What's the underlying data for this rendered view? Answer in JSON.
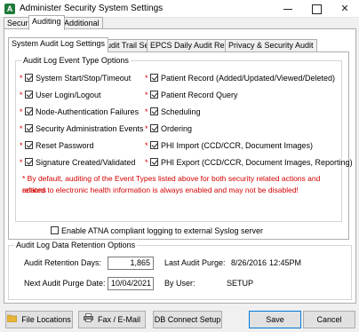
{
  "window": {
    "icon_letter": "A",
    "title": "Administer Security System Settings"
  },
  "top_tabs": [
    "Security",
    "Auditing",
    "Additional Options"
  ],
  "inner_tabs": [
    "System Audit Log Settings",
    "PHI Audit Trail Settings",
    "EPCS Daily Audit Reporting",
    "Privacy & Security Audit"
  ],
  "event_types": {
    "legend": "Audit Log Event Type Options",
    "left": [
      {
        "label": "System Start/Stop/Timeout",
        "required": true,
        "checked": true
      },
      {
        "label": "User Login/Logout",
        "required": true,
        "checked": true
      },
      {
        "label": "Node-Authentication Failures",
        "required": true,
        "checked": true
      },
      {
        "label": "Security Administration Events",
        "required": true,
        "checked": true
      },
      {
        "label": "Reset Password",
        "required": true,
        "checked": true
      },
      {
        "label": "Signature Created/Validated",
        "required": true,
        "checked": true
      }
    ],
    "right": [
      {
        "label": "Patient Record (Added/Updated/Viewed/Deleted)",
        "required": true,
        "checked": true
      },
      {
        "label": "Patient Record Query",
        "required": true,
        "checked": true
      },
      {
        "label": "Scheduling",
        "required": true,
        "checked": true
      },
      {
        "label": "Ordering",
        "required": true,
        "checked": true
      },
      {
        "label": "PHI Import (CCD/CCR, Document Images)",
        "required": true,
        "checked": true
      },
      {
        "label": "PHI Export (CCD/CCR, Document Images, Reporting)",
        "required": true,
        "checked": true
      }
    ],
    "star_glyph": "*",
    "note_line1": "* By default, auditing of the Event Types listed above for both security related actions and actions",
    "note_line2": "related to electronic health information is always enabled and may not be disabled!"
  },
  "syslog": {
    "label": "Enable ATNA compliant logging to external Syslog server",
    "checked": false
  },
  "retention": {
    "legend": "Audit Log Data Retention Options",
    "days_label": "Audit Retention Days:",
    "days_value": "1,865",
    "last_purge_label": "Last Audit Purge:",
    "last_purge_date": "8/26/2016",
    "last_purge_time": "12:45PM",
    "next_purge_label": "Next Audit Purge Date:",
    "next_purge_value": "10/04/2021",
    "by_user_label": "By User:",
    "by_user_value": "SETUP"
  },
  "buttons": {
    "file_locations": {
      "label": "File Locations",
      "icon": "folder-icon"
    },
    "fax_email": {
      "label": "Fax / E-Mail",
      "icon": "printer-icon"
    },
    "db_connect": {
      "label": "DB Connect Setup"
    },
    "save": {
      "label": "Save"
    },
    "cancel": {
      "label": "Cancel"
    }
  },
  "colors": {
    "required_star": "#d40000",
    "note_text": "#d40000",
    "default_button_border": "#0078d7"
  }
}
